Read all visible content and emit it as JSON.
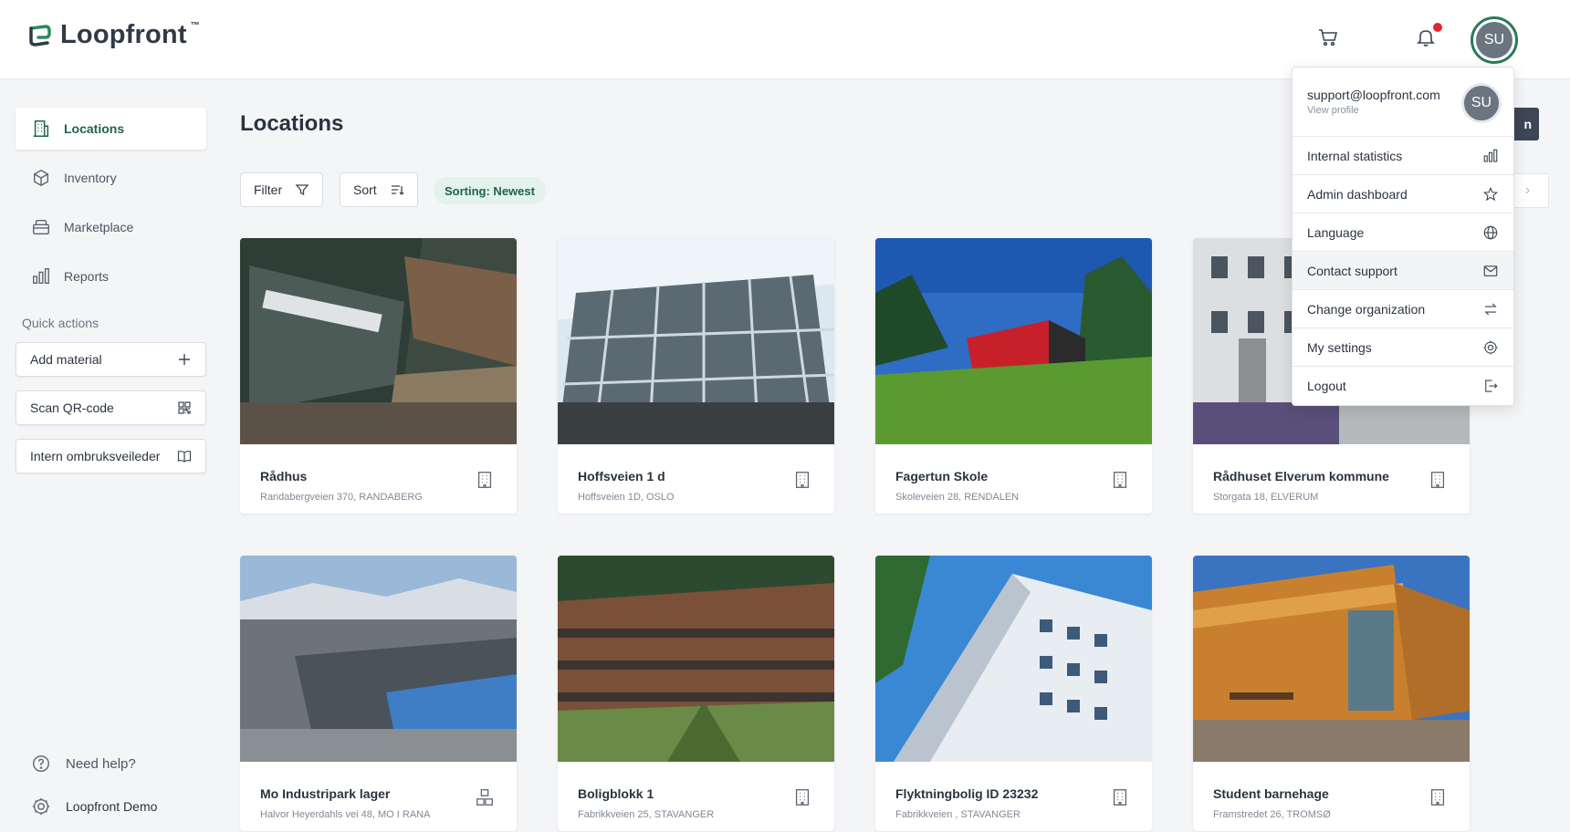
{
  "brand": {
    "name": "Loopfront",
    "tm": "™"
  },
  "header": {
    "avatar_initials": "SU"
  },
  "sidebar": {
    "nav": [
      {
        "label": "Locations",
        "icon": "building-icon"
      },
      {
        "label": "Inventory",
        "icon": "box-icon"
      },
      {
        "label": "Marketplace",
        "icon": "basket-icon"
      },
      {
        "label": "Reports",
        "icon": "bar-chart-icon"
      }
    ],
    "quick_actions_title": "Quick actions",
    "quick_actions": [
      {
        "label": "Add material",
        "icon": "plus-icon"
      },
      {
        "label": "Scan QR-code",
        "icon": "qr-icon"
      },
      {
        "label": "Intern ombruksveileder",
        "icon": "book-icon"
      }
    ],
    "help_label": "Need help?",
    "org_label": "Loopfront Demo"
  },
  "main": {
    "title": "Locations",
    "filter_label": "Filter",
    "sort_label": "Sort",
    "sorting_pill": "Sorting: Newest",
    "partial_button_text": "n",
    "partial_pager_glyph": "›"
  },
  "cards": [
    {
      "name": "Rådhus",
      "address": "Randabergveien 370, RANDABERG",
      "type_icon": "building-icon"
    },
    {
      "name": "Hoffsveien 1 d",
      "address": "Hoffsveien 1D, OSLO",
      "type_icon": "building-icon"
    },
    {
      "name": "Fagertun Skole",
      "address": "Skoleveien 28, RENDALEN",
      "type_icon": "building-icon"
    },
    {
      "name": "Rådhuset Elverum kommune",
      "address": "Storgata 18, ELVERUM",
      "type_icon": "building-icon"
    },
    {
      "name": "Mo Industripark lager",
      "address": "Halvor Heyerdahls vei 48, MO I RANA",
      "type_icon": "warehouse-icon"
    },
    {
      "name": "Boligblokk 1",
      "address": "Fabrikkveien 25, STAVANGER",
      "type_icon": "building-icon"
    },
    {
      "name": "Flyktningbolig ID 23232",
      "address": "Fabrikkveien , STAVANGER",
      "type_icon": "building-icon"
    },
    {
      "name": "Student barnehage",
      "address": "Framstredet 26, TROMSØ",
      "type_icon": "building-icon"
    }
  ],
  "profile_menu": {
    "email": "support@loopfront.com",
    "view_profile": "View profile",
    "avatar_initials": "SU",
    "items": [
      {
        "label": "Internal statistics",
        "icon": "bar-chart-icon"
      },
      {
        "label": "Admin dashboard",
        "icon": "star-icon"
      },
      {
        "label": "Language",
        "icon": "globe-icon"
      },
      {
        "label": "Contact support",
        "icon": "mail-icon"
      },
      {
        "label": "Change organization",
        "icon": "swap-icon"
      },
      {
        "label": "My settings",
        "icon": "gear-icon"
      },
      {
        "label": "Logout",
        "icon": "logout-icon"
      }
    ]
  },
  "colors": {
    "accent": "#20634a",
    "avatar_ring": "#2a7a5a",
    "notification": "#e3262f"
  }
}
